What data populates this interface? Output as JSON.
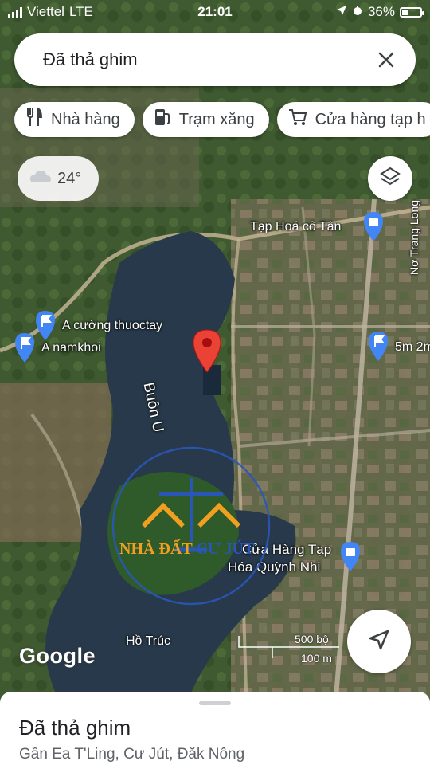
{
  "status": {
    "carrier": "Viettel",
    "network": "LTE",
    "time": "21:01",
    "battery": "36%",
    "battery_level": 0.36
  },
  "search": {
    "query": "Đã thả ghim"
  },
  "chips": [
    {
      "label": "Nhà hàng",
      "icon": "restaurant-icon"
    },
    {
      "label": "Trạm xăng",
      "icon": "gas-station-icon"
    },
    {
      "label": "Cửa hàng tạp h",
      "icon": "shopping-cart-icon"
    }
  ],
  "weather": {
    "temp": "24°",
    "icon": "cloud-icon"
  },
  "map_labels": {
    "tap_hoa_co_tan": "Tạp Hoá cô Tân",
    "no_trang_long": "Nơ Trang Long",
    "a_cuong": "A cường thuoctay",
    "a_namkhoi": "A namkhoi",
    "five_m": "5m 2m",
    "buon_u": "Buôn U",
    "cua_hang_line1": "Cửa Hàng Tạp",
    "cua_hang_line2": "Hóa Quỳnh Nhi",
    "ho_truc": "Hồ Trúc"
  },
  "google_logo": "Google",
  "scale": {
    "ft": "500 bộ",
    "m": "100 m"
  },
  "watermark": {
    "text_a": "NHÀ ĐẤT",
    "text_b": "CƯ JÚT"
  },
  "sheet": {
    "title": "Đã thả ghim",
    "subtitle": "Gần Ea T'Ling, Cư Jút, Đăk Nông"
  },
  "colors": {
    "pin_red": "#ea4335",
    "poi_blue": "#4285f4",
    "water": "#27394a"
  }
}
